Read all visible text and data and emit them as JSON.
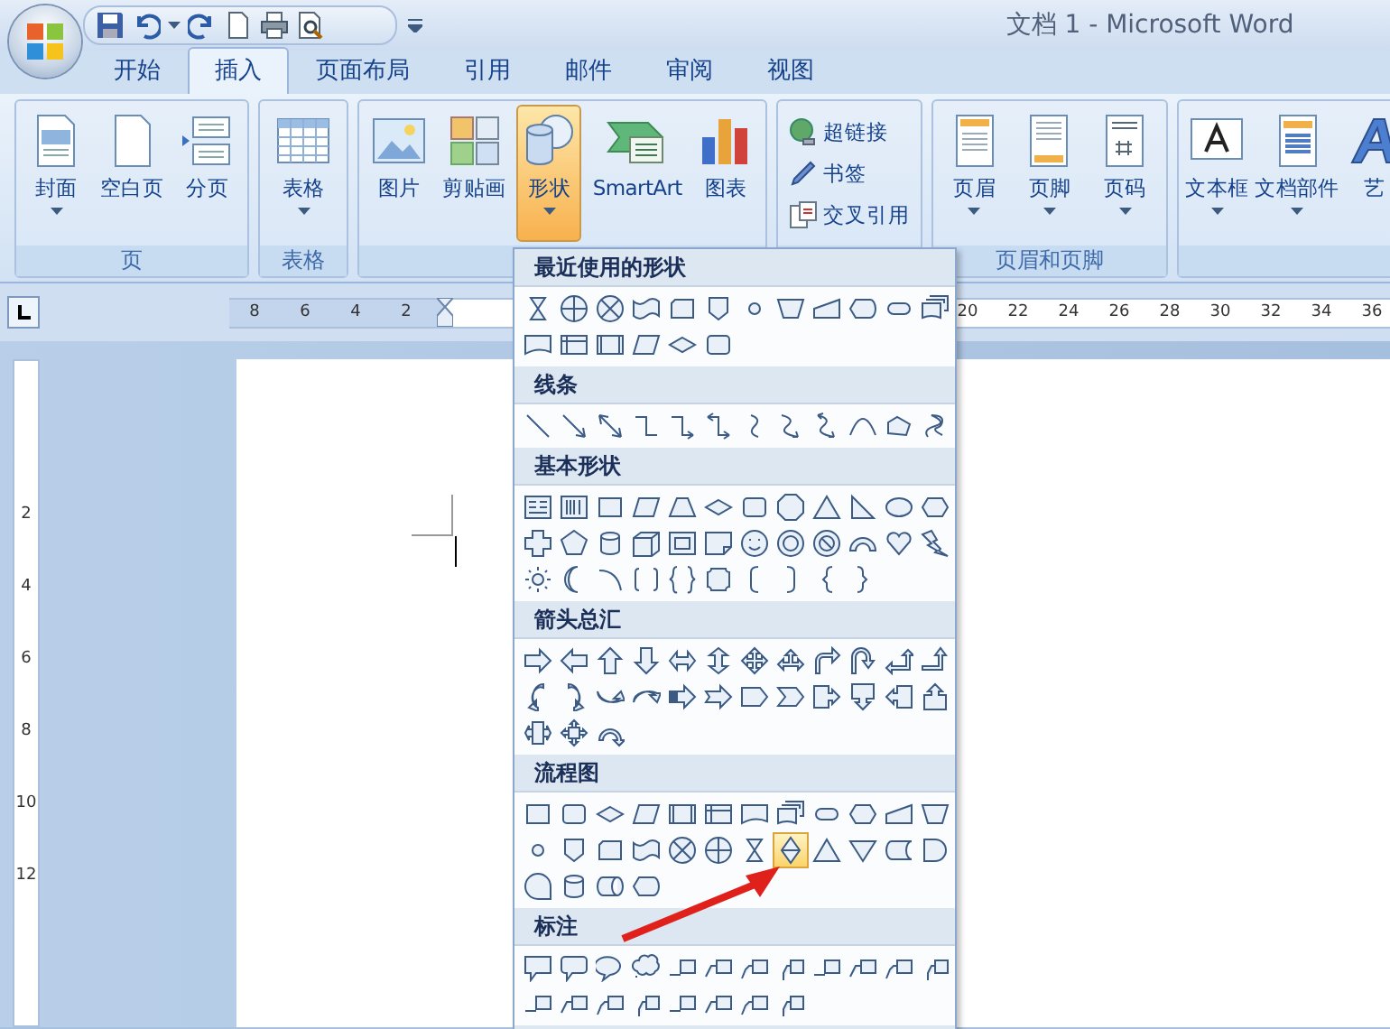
{
  "window": {
    "title": "文档 1 - Microsoft Word"
  },
  "tabs": [
    {
      "label": "开始",
      "selected": false
    },
    {
      "label": "插入",
      "selected": true
    },
    {
      "label": "页面布局",
      "selected": false
    },
    {
      "label": "引用",
      "selected": false
    },
    {
      "label": "邮件",
      "selected": false
    },
    {
      "label": "审阅",
      "selected": false
    },
    {
      "label": "视图",
      "selected": false
    }
  ],
  "ribbon_groups": [
    {
      "label": "页",
      "buttons": [
        {
          "label": "封面",
          "kind": "large",
          "menu": true,
          "selected": false
        },
        {
          "label": "空白页",
          "kind": "large",
          "menu": false,
          "selected": false
        },
        {
          "label": "分页",
          "kind": "large",
          "menu": false,
          "selected": false
        }
      ]
    },
    {
      "label": "表格",
      "buttons": [
        {
          "label": "表格",
          "kind": "large",
          "menu": true,
          "selected": false
        }
      ]
    },
    {
      "buttons": [
        {
          "label": "图片",
          "kind": "large",
          "menu": false,
          "selected": false
        },
        {
          "label": "剪贴画",
          "kind": "large",
          "menu": false,
          "selected": false
        },
        {
          "label": "形状",
          "kind": "large",
          "menu": true,
          "selected": true
        },
        {
          "label": "SmartArt",
          "kind": "large",
          "menu": false,
          "selected": false
        },
        {
          "label": "图表",
          "kind": "large",
          "menu": false,
          "selected": false
        }
      ]
    },
    {
      "buttons": [
        {
          "label": "超链接",
          "kind": "small",
          "menu": false,
          "selected": false
        },
        {
          "label": "书签",
          "kind": "small",
          "menu": false,
          "selected": false
        },
        {
          "label": "交叉引用",
          "kind": "small",
          "menu": false,
          "selected": false
        }
      ]
    },
    {
      "label": "页眉和页脚",
      "buttons": [
        {
          "label": "页眉",
          "kind": "large",
          "menu": true,
          "selected": false
        },
        {
          "label": "页脚",
          "kind": "large",
          "menu": true,
          "selected": false
        },
        {
          "label": "页码",
          "kind": "large",
          "menu": true,
          "selected": false
        }
      ]
    },
    {
      "buttons": [
        {
          "label": "文本框",
          "kind": "large",
          "menu": true,
          "selected": false
        },
        {
          "label": "文档部件",
          "kind": "large",
          "menu": true,
          "selected": false
        },
        {
          "label": "艺",
          "kind": "large",
          "menu": false,
          "selected": false
        }
      ]
    }
  ],
  "ruler": {
    "left_labels": [
      "8",
      "6",
      "4",
      "2"
    ],
    "right_labels": [
      "20",
      "22",
      "24",
      "26",
      "28",
      "30",
      "32",
      "34",
      "36"
    ]
  },
  "vertical_ruler": {
    "labels": [
      "2",
      "4",
      "6",
      "8",
      "10",
      "12"
    ]
  },
  "shapes_menu": {
    "sections": [
      {
        "title": "最近使用的形状",
        "shapes": [
          {
            "kind": "hourglass",
            "selected": false
          },
          {
            "kind": "circle-plus",
            "selected": false
          },
          {
            "kind": "circle-x",
            "selected": false
          },
          {
            "kind": "wave",
            "selected": false
          },
          {
            "kind": "snipped-rect",
            "selected": false
          },
          {
            "kind": "pentagon-down",
            "selected": false
          },
          {
            "kind": "small-circle",
            "selected": false
          },
          {
            "kind": "inverted-trapezoid",
            "selected": false
          },
          {
            "kind": "slanted-rect",
            "selected": false
          },
          {
            "kind": "pointed-oval",
            "selected": false
          },
          {
            "kind": "stadium",
            "selected": false
          },
          {
            "kind": "stacked-document",
            "selected": false
          },
          {
            "kind": "document",
            "selected": false
          },
          {
            "kind": "internal-storage",
            "selected": false
          },
          {
            "kind": "framed-rect",
            "selected": false
          },
          {
            "kind": "parallelogram",
            "selected": false
          },
          {
            "kind": "diamond",
            "selected": false
          },
          {
            "kind": "rounded-rect",
            "selected": false
          }
        ]
      },
      {
        "title": "线条",
        "shapes": [
          {
            "kind": "line",
            "selected": false
          },
          {
            "kind": "arrow-line",
            "selected": false
          },
          {
            "kind": "double-arrow-line",
            "selected": false
          },
          {
            "kind": "elbow-line",
            "selected": false
          },
          {
            "kind": "elbow-arrow",
            "selected": false
          },
          {
            "kind": "elbow-double-arrow",
            "selected": false
          },
          {
            "kind": "curve-line",
            "selected": false
          },
          {
            "kind": "curve-arrow",
            "selected": false
          },
          {
            "kind": "curve-double-arrow",
            "selected": false
          },
          {
            "kind": "arch-line",
            "selected": false
          },
          {
            "kind": "freeform",
            "selected": false
          },
          {
            "kind": "scribble",
            "selected": false
          }
        ]
      },
      {
        "title": "基本形状",
        "shapes": [
          {
            "kind": "text-box",
            "selected": false
          },
          {
            "kind": "vertical-text-box",
            "selected": false
          },
          {
            "kind": "rectangle",
            "selected": false
          },
          {
            "kind": "parallelogram",
            "selected": false
          },
          {
            "kind": "trapezoid",
            "selected": false
          },
          {
            "kind": "diamond",
            "selected": false
          },
          {
            "kind": "rounded-rect",
            "selected": false
          },
          {
            "kind": "octagon",
            "selected": false
          },
          {
            "kind": "triangle",
            "selected": false
          },
          {
            "kind": "right-triangle",
            "selected": false
          },
          {
            "kind": "ellipse",
            "selected": false
          },
          {
            "kind": "hexagon",
            "selected": false
          },
          {
            "kind": "cross",
            "selected": false
          },
          {
            "kind": "pentagon",
            "selected": false
          },
          {
            "kind": "cylinder",
            "selected": false
          },
          {
            "kind": "cube",
            "selected": false
          },
          {
            "kind": "bevel",
            "selected": false
          },
          {
            "kind": "folded-corner",
            "selected": false
          },
          {
            "kind": "smiley",
            "selected": false
          },
          {
            "kind": "donut",
            "selected": false
          },
          {
            "kind": "no-symbol",
            "selected": false
          },
          {
            "kind": "block-arc",
            "selected": false
          },
          {
            "kind": "heart",
            "selected": false
          },
          {
            "kind": "lightning",
            "selected": false
          },
          {
            "kind": "sun",
            "selected": false
          },
          {
            "kind": "moon",
            "selected": false
          },
          {
            "kind": "arc",
            "selected": false
          },
          {
            "kind": "bracket-pair",
            "selected": false
          },
          {
            "kind": "brace-pair",
            "selected": false
          },
          {
            "kind": "plaque",
            "selected": false
          },
          {
            "kind": "left-bracket",
            "selected": false
          },
          {
            "kind": "right-bracket",
            "selected": false
          },
          {
            "kind": "left-brace",
            "selected": false
          },
          {
            "kind": "right-brace",
            "selected": false
          }
        ]
      },
      {
        "title": "箭头总汇",
        "shapes": [
          {
            "kind": "right-arrow",
            "selected": false
          },
          {
            "kind": "left-arrow",
            "selected": false
          },
          {
            "kind": "up-arrow",
            "selected": false
          },
          {
            "kind": "down-arrow",
            "selected": false
          },
          {
            "kind": "left-right-arrow",
            "selected": false
          },
          {
            "kind": "up-down-arrow",
            "selected": false
          },
          {
            "kind": "quad-arrow",
            "selected": false
          },
          {
            "kind": "three-way-arrow",
            "selected": false
          },
          {
            "kind": "bent-arrow",
            "selected": false
          },
          {
            "kind": "u-turn-arrow",
            "selected": false
          },
          {
            "kind": "left-up-arrow",
            "selected": false
          },
          {
            "kind": "bent-up-arrow",
            "selected": false
          },
          {
            "kind": "curved-right-arrow",
            "selected": false
          },
          {
            "kind": "curved-left-arrow",
            "selected": false
          },
          {
            "kind": "curved-up-arrow",
            "selected": false
          },
          {
            "kind": "curved-down-arrow",
            "selected": false
          },
          {
            "kind": "striped-arrow",
            "selected": false
          },
          {
            "kind": "notched-arrow",
            "selected": false
          },
          {
            "kind": "home-plate",
            "selected": false
          },
          {
            "kind": "chevron",
            "selected": false
          },
          {
            "kind": "right-arrow-callout",
            "selected": false
          },
          {
            "kind": "down-arrow-callout",
            "selected": false
          },
          {
            "kind": "left-arrow-callout",
            "selected": false
          },
          {
            "kind": "up-arrow-callout",
            "selected": false
          },
          {
            "kind": "left-right-arrow-callout",
            "selected": false
          },
          {
            "kind": "quad-arrow-callout",
            "selected": false
          },
          {
            "kind": "circular-arrow",
            "selected": false
          }
        ]
      },
      {
        "title": "流程图",
        "shapes": [
          {
            "kind": "rectangle",
            "selected": false
          },
          {
            "kind": "rounded-rect",
            "selected": false
          },
          {
            "kind": "diamond",
            "selected": false
          },
          {
            "kind": "parallelogram",
            "selected": false
          },
          {
            "kind": "framed-rect",
            "selected": false
          },
          {
            "kind": "internal-storage",
            "selected": false
          },
          {
            "kind": "document",
            "selected": false
          },
          {
            "kind": "stacked-document",
            "selected": false
          },
          {
            "kind": "stadium",
            "selected": false
          },
          {
            "kind": "hexagon",
            "selected": false
          },
          {
            "kind": "slanted-rect",
            "selected": false
          },
          {
            "kind": "inverted-trapezoid",
            "selected": false
          },
          {
            "kind": "small-circle",
            "selected": false
          },
          {
            "kind": "pentagon-down",
            "selected": false
          },
          {
            "kind": "snipped-rect",
            "selected": false
          },
          {
            "kind": "wave",
            "selected": false
          },
          {
            "kind": "circle-x",
            "selected": false
          },
          {
            "kind": "circle-plus",
            "selected": false
          },
          {
            "kind": "hourglass",
            "selected": false
          },
          {
            "kind": "split-diamond",
            "selected": true
          },
          {
            "kind": "triangle",
            "selected": false
          },
          {
            "kind": "inverted-triangle",
            "selected": false
          },
          {
            "kind": "stored-data",
            "selected": false
          },
          {
            "kind": "delay",
            "selected": false
          },
          {
            "kind": "sequential-access",
            "selected": false
          },
          {
            "kind": "cylinder",
            "selected": false
          },
          {
            "kind": "horizontal-cylinder",
            "selected": false
          },
          {
            "kind": "pointed-oval",
            "selected": false
          }
        ]
      },
      {
        "title": "标注",
        "shapes": [
          {
            "kind": "rect-callout",
            "selected": false
          },
          {
            "kind": "rounded-callout",
            "selected": false
          },
          {
            "kind": "oval-callout",
            "selected": false
          },
          {
            "kind": "cloud-callout",
            "selected": false
          },
          {
            "kind": "line-callout",
            "selected": false
          },
          {
            "kind": "bent-line-callout",
            "selected": false
          },
          {
            "kind": "double-bent-callout",
            "selected": false
          },
          {
            "kind": "hook-line-callout",
            "selected": false
          },
          {
            "kind": "line-callout",
            "selected": false
          },
          {
            "kind": "bent-line-callout",
            "selected": false
          },
          {
            "kind": "double-bent-callout",
            "selected": false
          },
          {
            "kind": "hook-line-callout",
            "selected": false
          },
          {
            "kind": "line-callout",
            "selected": false
          },
          {
            "kind": "bent-line-callout",
            "selected": false
          },
          {
            "kind": "double-bent-callout",
            "selected": false
          },
          {
            "kind": "hook-line-callout",
            "selected": false
          },
          {
            "kind": "line-callout",
            "selected": false
          },
          {
            "kind": "bent-line-callout",
            "selected": false
          },
          {
            "kind": "double-bent-callout",
            "selected": false
          },
          {
            "kind": "hook-line-callout",
            "selected": false
          }
        ]
      }
    ]
  }
}
